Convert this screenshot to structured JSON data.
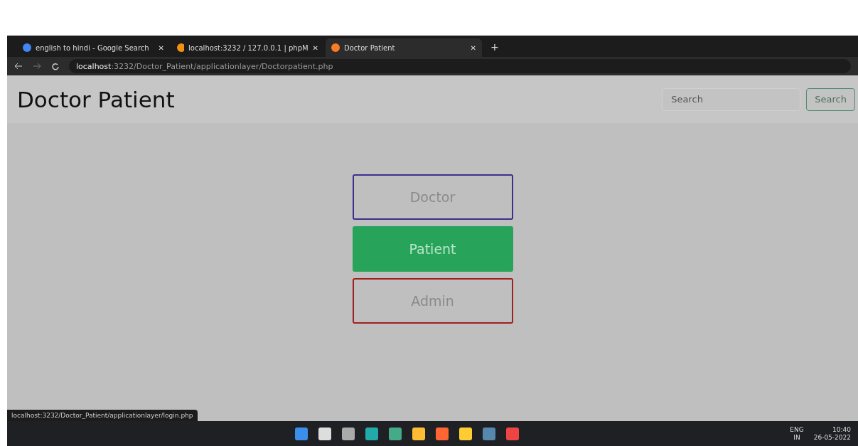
{
  "browser": {
    "tabs": [
      {
        "title": "english to hindi - Google Search",
        "close": "✕",
        "selected": false,
        "kind": "google"
      },
      {
        "title": "localhost:3232 / 127.0.0.1 | phpM",
        "close": "✕",
        "selected": false,
        "kind": "php"
      },
      {
        "title": "Doctor Patient",
        "close": "✕",
        "selected": true,
        "kind": "xampp"
      }
    ],
    "new_tab": "+",
    "address": {
      "host": "localhost",
      "path": ":3232/Doctor_Patient/applicationlayer/Doctorpatient.php"
    }
  },
  "page": {
    "title": "Doctor Patient",
    "search": {
      "placeholder": "Search",
      "button": "Search"
    },
    "roles": [
      {
        "label": "Doctor",
        "kind": "outline",
        "color": "#3d2f8f"
      },
      {
        "label": "Patient",
        "kind": "filled",
        "color": "#27a35a"
      },
      {
        "label": "Admin",
        "kind": "outline",
        "color": "#a02020"
      }
    ]
  },
  "status_url": "localhost:3232/Doctor_Patient/applicationlayer/login.php",
  "taskbar": {
    "lang": "ENG",
    "region": "IN",
    "time": "10:40",
    "date": "26-05-2022"
  }
}
